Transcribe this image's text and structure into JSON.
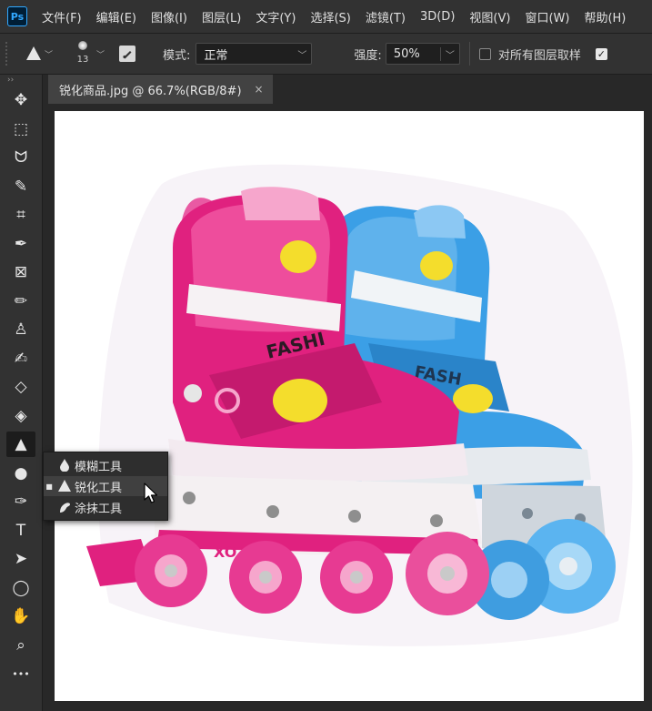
{
  "app": {
    "logo_text": "Ps"
  },
  "menu": [
    "文件(F)",
    "编辑(E)",
    "图像(I)",
    "图层(L)",
    "文字(Y)",
    "选择(S)",
    "滤镜(T)",
    "3D(D)",
    "视图(V)",
    "窗口(W)",
    "帮助(H)"
  ],
  "options": {
    "brush_size": "13",
    "mode_label": "模式:",
    "mode_value": "正常",
    "strength_label": "强度:",
    "strength_value": "50%",
    "sample_all_layers_label": "对所有图层取样",
    "protect_detail_checked": true
  },
  "document": {
    "tab_title": "锐化商品.jpg @ 66.7%(RGB/8#)",
    "close_glyph": "×"
  },
  "toolbar": {
    "head_glyph": "››",
    "tools": [
      {
        "name": "move-tool",
        "icon": "✥"
      },
      {
        "name": "marquee-tool",
        "icon": "⬚"
      },
      {
        "name": "lasso-tool",
        "icon": "ᗢ"
      },
      {
        "name": "quick-select-tool",
        "icon": "✎"
      },
      {
        "name": "crop-tool",
        "icon": "⌗"
      },
      {
        "name": "eyedropper-tool",
        "icon": "✒"
      },
      {
        "name": "frame-tool",
        "icon": "⊠"
      },
      {
        "name": "brush-tool",
        "icon": "✏"
      },
      {
        "name": "clone-stamp-tool",
        "icon": "♙"
      },
      {
        "name": "history-brush-tool",
        "icon": "✍"
      },
      {
        "name": "eraser-tool",
        "icon": "◇"
      },
      {
        "name": "paint-bucket-tool",
        "icon": "◈"
      },
      {
        "name": "sharpen-tool",
        "icon": "▲",
        "active": true
      },
      {
        "name": "dodge-tool",
        "icon": "●"
      },
      {
        "name": "pen-tool",
        "icon": "✑"
      },
      {
        "name": "type-tool",
        "icon": "T"
      },
      {
        "name": "path-select-tool",
        "icon": "➤"
      },
      {
        "name": "ellipse-tool",
        "icon": "◯"
      },
      {
        "name": "hand-tool",
        "icon": "✋"
      },
      {
        "name": "zoom-tool",
        "icon": "⌕"
      },
      {
        "name": "more-tools",
        "icon": "•••"
      }
    ]
  },
  "flyout": {
    "items": [
      {
        "label": "模糊工具",
        "icon": "blur-drop-icon",
        "selected": false
      },
      {
        "label": "锐化工具",
        "icon": "sharpen-triangle-icon",
        "selected": true,
        "marker": "■"
      },
      {
        "label": "涂抹工具",
        "icon": "smudge-finger-icon",
        "selected": false
      }
    ]
  },
  "canvas_image": {
    "graphic_text": [
      "FASHI",
      "FASH",
      "XO",
      "XO"
    ]
  },
  "colors": {
    "pink": "#e0217f",
    "light_pink": "#f6a6cc",
    "blue": "#3b9fe6",
    "light_blue": "#8cc8f3",
    "yellow": "#f4dd2c",
    "ui_bg": "#323232"
  }
}
